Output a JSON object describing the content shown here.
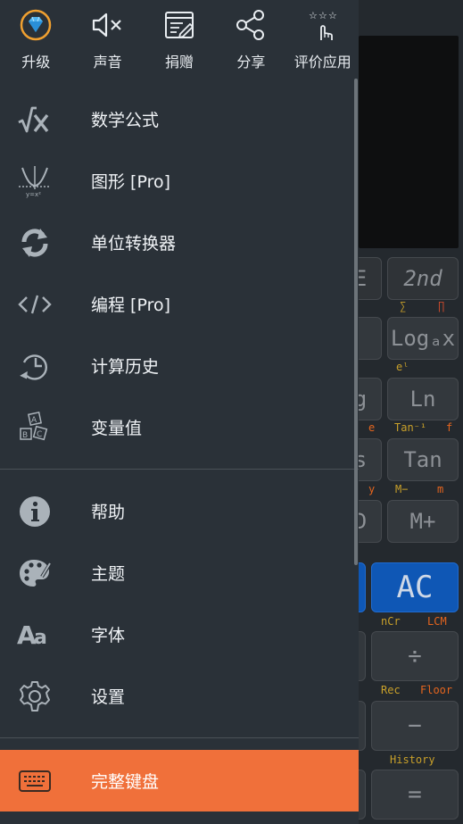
{
  "top_actions": [
    {
      "label": "升级",
      "icon": "diamond-icon"
    },
    {
      "label": "声音",
      "icon": "speaker-mute-icon"
    },
    {
      "label": "捐赠",
      "icon": "donate-window-icon"
    },
    {
      "label": "分享",
      "icon": "share-icon"
    },
    {
      "label": "评价应用",
      "icon": "rate-stars-icon"
    }
  ],
  "menu": {
    "formulas": "数学公式",
    "graph": "图形 [Pro]",
    "unit_converter": "单位转换器",
    "programming": "编程 [Pro]",
    "history": "计算历史",
    "variables": "变量值",
    "help": "帮助",
    "theme": "主题",
    "font": "字体",
    "settings": "设置",
    "full_keyboard": "完整键盘"
  },
  "calculator": {
    "keys": {
      "e_key": "E",
      "second": "2nd",
      "loga": "Logₐx",
      "g_key": "g",
      "ln": "Ln",
      "s_key": "s",
      "tan": "Tan",
      "d_key": "D",
      "mplus": "M+",
      "ac": "AC",
      "divide": "÷",
      "minus": "−",
      "equals": "="
    },
    "shift_labels": {
      "sum": "∑",
      "prod": "∏",
      "e_exp": "eˡ",
      "e": "e",
      "tan_inv": "Tan⁻¹",
      "f": "f",
      "y": "y",
      "m_minus": "M−",
      "m": "m",
      "ncr": "nCr",
      "lcm": "LCM",
      "rec": "Rec",
      "floor": "Floor",
      "history": "History"
    }
  },
  "colors": {
    "drawer_bg": "#2a3138",
    "highlight": "#f0703a",
    "ac_key": "#0f57b5"
  }
}
